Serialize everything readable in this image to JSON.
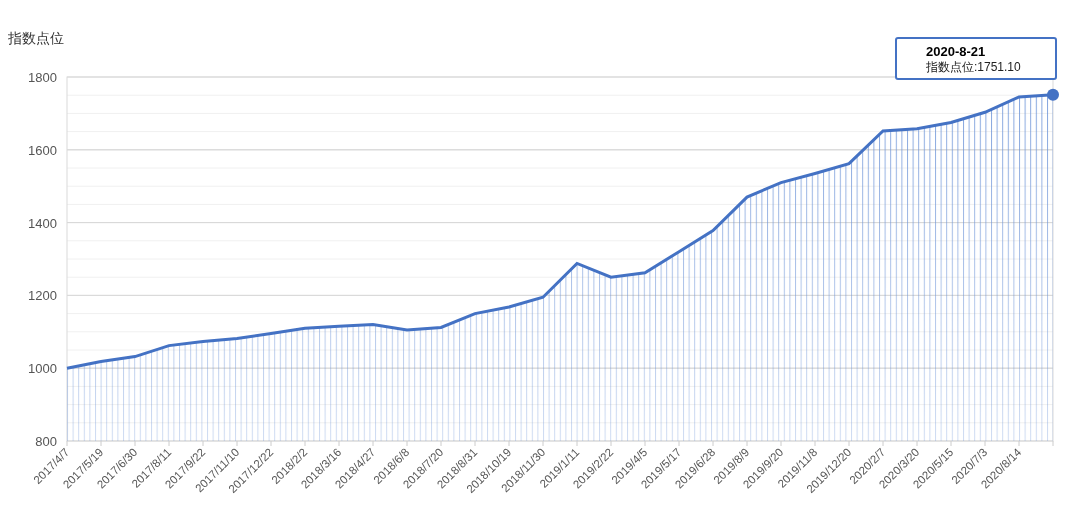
{
  "chart": {
    "chart_data": {
      "type": "area",
      "grid": true,
      "ylabel": "指数点位",
      "categories": [
        "2017/4/7",
        "2017/5/19",
        "2017/6/30",
        "2017/8/11",
        "2017/9/22",
        "2017/11/10",
        "2017/12/22",
        "2018/2/2",
        "2018/3/16",
        "2018/4/27",
        "2018/6/8",
        "2018/7/20",
        "2018/8/31",
        "2018/10/19",
        "2018/11/30",
        "2019/1/11",
        "2019/2/22",
        "2019/4/5",
        "2019/5/17",
        "2019/6/28",
        "2019/8/9",
        "2019/9/20",
        "2019/11/8",
        "2019/12/20",
        "2020/2/7",
        "2020/3/20",
        "2020/5/15",
        "2020/7/3",
        "2020/8/14",
        null
      ],
      "series": [
        {
          "color": "#4472c4",
          "values": [
            1000,
            1018,
            1032,
            1062,
            1073,
            1082,
            1095,
            1110,
            1115,
            1120,
            1105,
            1112,
            1150,
            1168,
            1195,
            1288,
            1250,
            1262,
            1320,
            1378,
            1470,
            1510,
            1535,
            1562,
            1652,
            1658,
            1675,
            1703,
            1745,
            1751
          ]
        }
      ],
      "ylim": [
        800,
        1800
      ],
      "yticks": [
        800,
        1000,
        1200,
        1400,
        1600,
        1800
      ]
    },
    "tooltip": {
      "title": "2020-8-21",
      "label": "指数点位:1751.10"
    }
  }
}
